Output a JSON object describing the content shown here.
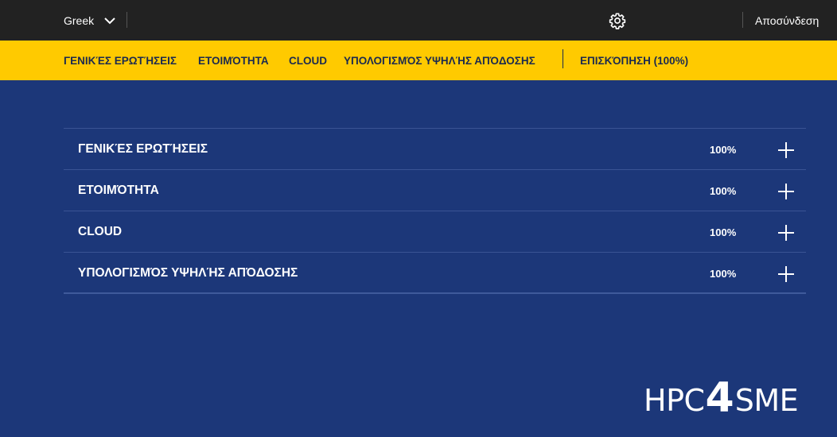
{
  "topbar": {
    "language": "Greek",
    "logout_label": "Αποσύνδεση"
  },
  "nav": {
    "items": [
      "ΓΕΝΙΚΈΣ ΕΡΩΤΉΣΕΙΣ",
      "ΕΤΟΙΜΌΤΗΤΑ",
      "CLOUD",
      "ΥΠΟΛΟΓΙΣΜΌΣ ΥΨΗΛΉΣ ΑΠΌΔΟΣΗΣ"
    ],
    "overview": "ΕΠΙΣΚΌΠΗΣΗ (100%)"
  },
  "sections": [
    {
      "title": "ΓΕΝΙΚΈΣ ΕΡΩΤΉΣΕΙΣ",
      "percent": "100%"
    },
    {
      "title": "ΕΤΟΙΜΌΤΗΤΑ",
      "percent": "100%"
    },
    {
      "title": "CLOUD",
      "percent": "100%"
    },
    {
      "title": "ΥΠΟΛΟΓΙΣΜΌΣ ΥΨΗΛΉΣ ΑΠΌΔΟΣΗΣ",
      "percent": "100%"
    }
  ],
  "logo": {
    "part1": "HPC",
    "part2": "4",
    "part3": "SME"
  },
  "colors": {
    "topbar_bg": "#222222",
    "nav_bg": "#ffca00",
    "page_bg": "#1c3779",
    "nav_text": "#1b2a4f"
  },
  "icons": {
    "language_dropdown": "chevron-down-icon",
    "settings": "gear-icon",
    "expand": "plus-icon"
  }
}
